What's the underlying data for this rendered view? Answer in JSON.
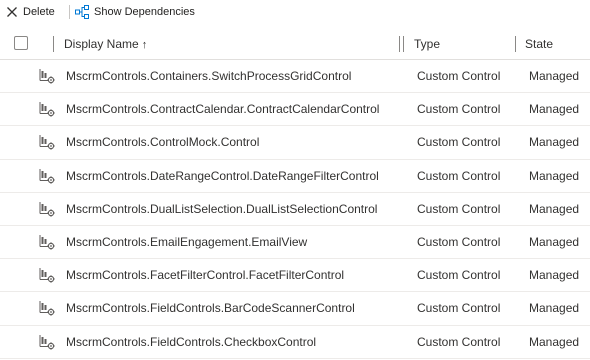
{
  "toolbar": {
    "delete_label": "Delete",
    "show_dependencies_label": "Show Dependencies"
  },
  "columns": {
    "display_name": "Display Name",
    "sort_indicator": "↑",
    "type": "Type",
    "state": "State"
  },
  "rows": [
    {
      "name": "MscrmControls.Containers.SwitchProcessGridControl",
      "type": "Custom Control",
      "state": "Managed"
    },
    {
      "name": "MscrmControls.ContractCalendar.ContractCalendarControl",
      "type": "Custom Control",
      "state": "Managed"
    },
    {
      "name": "MscrmControls.ControlMock.Control",
      "type": "Custom Control",
      "state": "Managed"
    },
    {
      "name": "MscrmControls.DateRangeControl.DateRangeFilterControl",
      "type": "Custom Control",
      "state": "Managed"
    },
    {
      "name": "MscrmControls.DualListSelection.DualListSelectionControl",
      "type": "Custom Control",
      "state": "Managed"
    },
    {
      "name": "MscrmControls.EmailEngagement.EmailView",
      "type": "Custom Control",
      "state": "Managed"
    },
    {
      "name": "MscrmControls.FacetFilterControl.FacetFilterControl",
      "type": "Custom Control",
      "state": "Managed"
    },
    {
      "name": "MscrmControls.FieldControls.BarCodeScannerControl",
      "type": "Custom Control",
      "state": "Managed"
    },
    {
      "name": "MscrmControls.FieldControls.CheckboxControl",
      "type": "Custom Control",
      "state": "Managed"
    }
  ]
}
